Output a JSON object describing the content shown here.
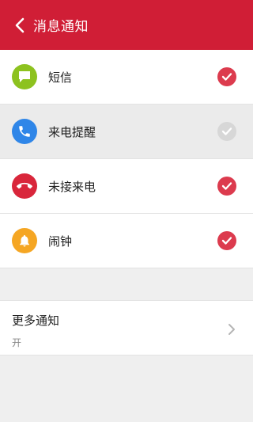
{
  "header": {
    "title": "消息通知",
    "back_icon": "chevron-left-icon"
  },
  "colors": {
    "header_bg": "#d01e36",
    "check_active": "#dc3b4e",
    "check_inactive": "#d7d7d7"
  },
  "items": [
    {
      "label": "短信",
      "icon": "message-icon",
      "icon_color": "#8dc21f",
      "checked": true
    },
    {
      "label": "来电提醒",
      "icon": "phone-icon",
      "icon_color": "#2f86e8",
      "checked": false
    },
    {
      "label": "未接来电",
      "icon": "missed-call-icon",
      "icon_color": "#d9263b",
      "checked": true
    },
    {
      "label": "闹钟",
      "icon": "bell-icon",
      "icon_color": "#f5a623",
      "checked": true
    }
  ],
  "more": {
    "title": "更多通知",
    "subtitle": "开",
    "icon": "chevron-right-icon"
  }
}
